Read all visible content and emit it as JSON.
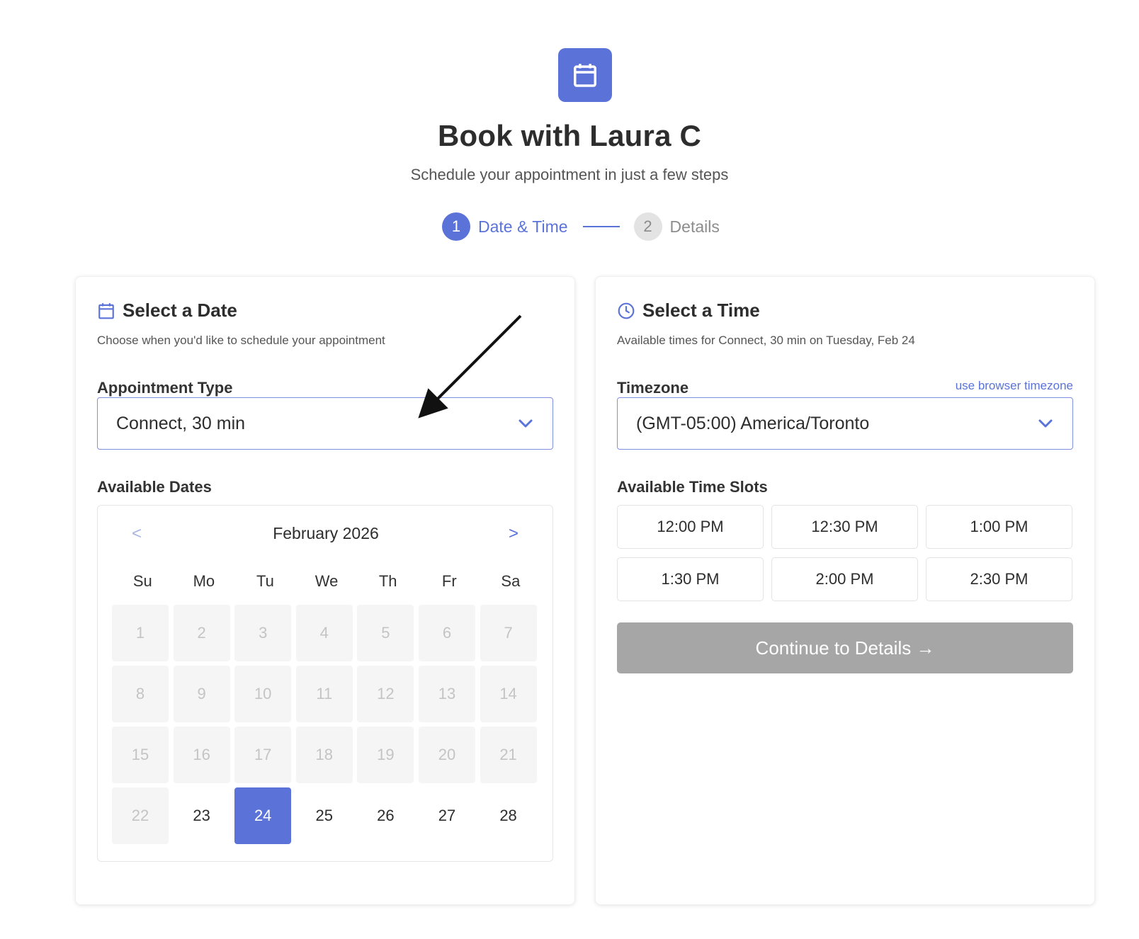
{
  "header": {
    "logo_icon": "calendar-icon",
    "title": "Book with Laura C",
    "subtitle": "Schedule your appointment in just a few steps"
  },
  "stepper": {
    "steps": [
      {
        "number": "1",
        "label": "Date & Time",
        "state": "active"
      },
      {
        "number": "2",
        "label": "Details",
        "state": "inactive"
      }
    ]
  },
  "date_panel": {
    "icon": "calendar-icon",
    "title": "Select a Date",
    "description": "Choose when you'd like to schedule your appointment",
    "appointment_type_label": "Appointment Type",
    "appointment_type_value": "Connect, 30 min",
    "available_dates_label": "Available Dates",
    "calendar": {
      "month": "February 2026",
      "prev": "<",
      "next": ">",
      "weekdays": [
        "Su",
        "Mo",
        "Tu",
        "We",
        "Th",
        "Fr",
        "Sa"
      ],
      "days": [
        "1",
        "2",
        "3",
        "4",
        "5",
        "6",
        "7",
        "8",
        "9",
        "10",
        "11",
        "12",
        "13",
        "14",
        "15",
        "16",
        "17",
        "18",
        "19",
        "20",
        "21",
        "22",
        "23",
        "24",
        "25",
        "26",
        "27",
        "28"
      ],
      "first_available_day": 23,
      "selected_day": 24
    }
  },
  "time_panel": {
    "icon": "clock-icon",
    "title": "Select a Time",
    "description": "Available times for Connect, 30 min on Tuesday, Feb 24",
    "timezone_label": "Timezone",
    "timezone_link": "use browser timezone",
    "timezone_value": "(GMT-05:00) America/Toronto",
    "slots_label": "Available Time Slots",
    "slots": [
      "12:00 PM",
      "12:30 PM",
      "1:00 PM",
      "1:30 PM",
      "2:00 PM",
      "2:30 PM"
    ],
    "continue_label": "Continue to Details →"
  },
  "colors": {
    "accent": "#5b73d9",
    "disabled_button": "#a6a6a6",
    "disabled_day": "#f5f5f5"
  }
}
